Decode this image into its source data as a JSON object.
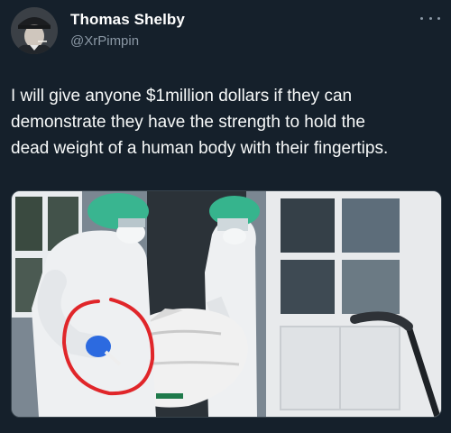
{
  "author": {
    "name": "Thomas Shelby",
    "handle": "@XrPimpin",
    "avatar_icon": "profile-photo-flat-cap-man"
  },
  "more_icon": "more-options-icon",
  "tweet": {
    "lines": [
      "I will give anyone $1million dollars if they can",
      "demonstrate they have the strength to hold the",
      "dead weight of a human body with their fingertips."
    ]
  },
  "media": {
    "description_icon": "photo-two-workers-in-hazmat-suits-carrying-body-bag",
    "highlight_color": "#e0262a"
  },
  "colors": {
    "background": "#15202b",
    "text": "#f7f9f9",
    "secondary_text": "#8b98a5"
  }
}
